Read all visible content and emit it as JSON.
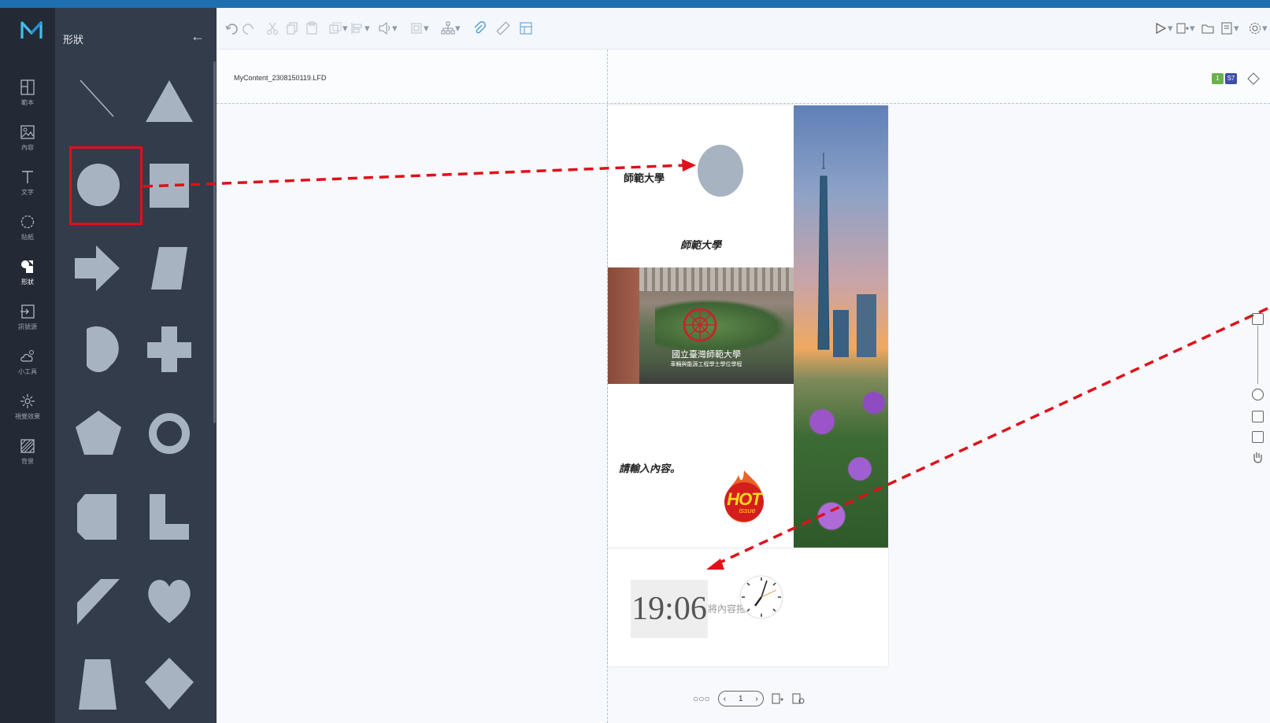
{
  "panel": {
    "title": "形狀",
    "back_icon": "arrow-left-icon"
  },
  "rail": {
    "items": [
      {
        "label": "範本",
        "icon": "template-icon"
      },
      {
        "label": "內容",
        "icon": "image-icon"
      },
      {
        "label": "文字",
        "icon": "text-icon"
      },
      {
        "label": "貼紙",
        "icon": "sticker-icon"
      },
      {
        "label": "形狀",
        "icon": "shapes-icon",
        "active": true
      },
      {
        "label": "訊號源",
        "icon": "signal-source-icon"
      },
      {
        "label": "小工具",
        "icon": "widget-icon"
      },
      {
        "label": "視覺效果",
        "icon": "visual-effect-icon"
      },
      {
        "label": "背景",
        "icon": "background-icon"
      }
    ]
  },
  "file": {
    "name": "MyContent_2308150119.LFD",
    "badge_green": "1",
    "badge_blue": "S7"
  },
  "canvas": {
    "text_top": "師範大學",
    "text_middle": "師範大學",
    "text_prompt": "請輸入內容。",
    "clock_time": "19:06",
    "clock_caption": "將內容拖",
    "hot_label": "HOT",
    "hot_sub": "issue",
    "campus_caption_1": "國立臺灣師範大學",
    "campus_caption_2": "車輛與能源工程學士學位學程"
  },
  "pager": {
    "page": "1"
  },
  "colors": {
    "accent": "#e0101a",
    "rail_bg": "#232a35",
    "panel_bg": "#333c4a",
    "shape_fill": "#a8b3c2",
    "title_bar": "#1e6fb0"
  }
}
